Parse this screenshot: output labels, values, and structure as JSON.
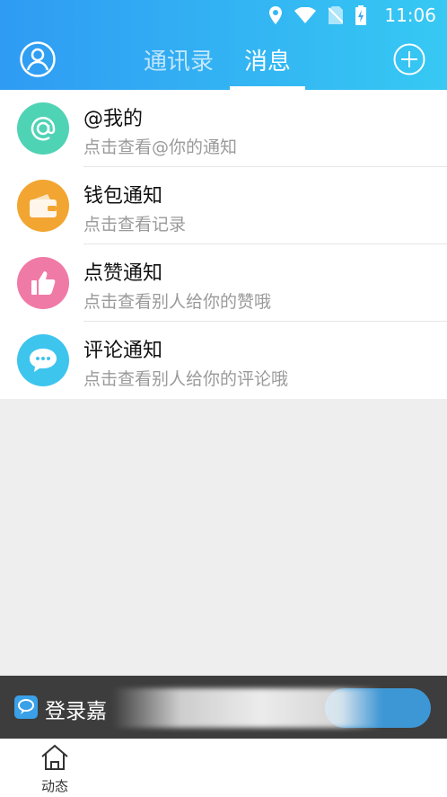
{
  "status_bar": {
    "time": "11:06"
  },
  "header": {
    "tabs": [
      {
        "label": "通讯录",
        "active": false
      },
      {
        "label": "消息",
        "active": true
      }
    ]
  },
  "notifications": [
    {
      "title": "@我的",
      "subtitle": "点击查看@你的通知",
      "icon": "at-icon",
      "color": "#4fd3b5"
    },
    {
      "title": "钱包通知",
      "subtitle": "点击查看记录",
      "icon": "wallet-icon",
      "color": "#f2a531"
    },
    {
      "title": "点赞通知",
      "subtitle": "点击查看别人给你的赞哦",
      "icon": "thumbs-up-icon",
      "color": "#f07aa6"
    },
    {
      "title": "评论通知",
      "subtitle": "点击查看别人给你的评论哦",
      "icon": "comment-icon",
      "color": "#3ec5ee"
    }
  ],
  "login_banner": {
    "text": "登录嘉"
  },
  "bottom_nav": {
    "items": [
      {
        "label": "动态",
        "icon": "home-icon"
      }
    ]
  }
}
